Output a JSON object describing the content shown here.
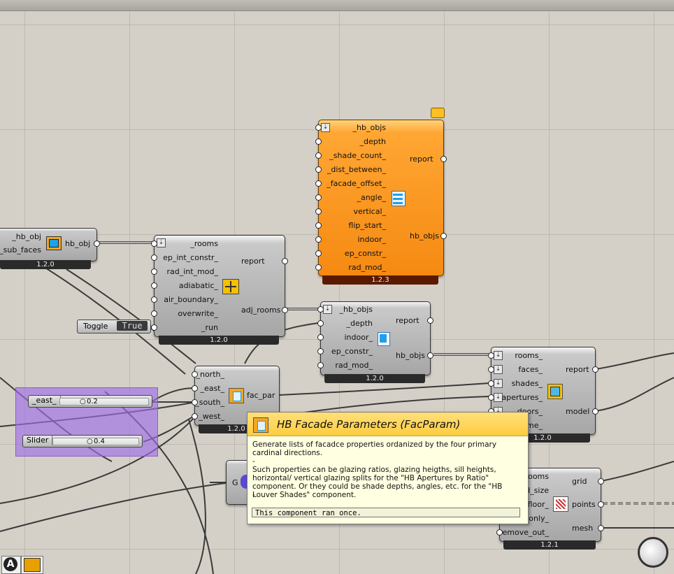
{
  "components": {
    "hb_add_subface": {
      "inputs": [
        "_hb_obj",
        "_sub_faces"
      ],
      "outputs": [
        "hb_obj"
      ],
      "version": "1.2.0"
    },
    "hb_solve_adjacency": {
      "inputs": [
        "_rooms",
        "ep_int_constr_",
        "rad_int_mod_",
        "adiabatic_",
        "air_boundary_",
        "overwrite_",
        "_run"
      ],
      "outputs": [
        "report",
        "adj_rooms"
      ],
      "version": "1.2.0"
    },
    "hb_louver_shades": {
      "inputs": [
        "_hb_objs",
        "_depth",
        "_shade_count_",
        "_dist_between_",
        "_facade_offset_",
        "_angle_",
        "vertical_",
        "flip_start_",
        "indoor_",
        "ep_constr_",
        "rad_mod_"
      ],
      "outputs": [
        "report",
        "hb_objs"
      ],
      "version": "1.2.3"
    },
    "hb_extruded_border": {
      "inputs": [
        "_hb_objs",
        "_depth",
        "indoor_",
        "ep_constr_",
        "rad_mod_"
      ],
      "outputs": [
        "report",
        "hb_objs"
      ],
      "version": "1.2.0"
    },
    "hb_model": {
      "inputs": [
        "rooms_",
        "faces_",
        "shades_",
        "apertures_",
        "doors_",
        "name_"
      ],
      "outputs": [
        "report",
        "model"
      ],
      "version": "1.2.0"
    },
    "hb_facade_parameters": {
      "inputs": [
        "_north_",
        "_east_",
        "_south_",
        "_west_"
      ],
      "outputs": [
        "fac_par"
      ],
      "version": "1.2.0"
    },
    "sensor_grid": {
      "inputs": [
        "rooms",
        "d_size",
        "floor_",
        "_only_",
        "remove_out_"
      ],
      "outputs": [
        "grid",
        "points",
        "mesh"
      ],
      "version": "1.2.1"
    },
    "g_component": {
      "label": "G"
    }
  },
  "toggle": {
    "label": "Toggle",
    "value": "True"
  },
  "sliders": [
    {
      "name": "_east_",
      "value": "0.2"
    },
    {
      "name": "Slider",
      "value": "0.4"
    }
  ],
  "tooltip": {
    "title": "HB Facade Parameters (FacParam)",
    "line1": "Generate lists of facadce properties ordanized by the four primary cardinal directions.",
    "line2": "-",
    "line3": "Such properties can be glazing ratios, glazing heigths, sill heights, horizontal/ vertical glazing splits for the \"HB Apertures by Ratio\" component. Or they could be shade depths, angles, etc. for the \"HB Louver Shades\" component.",
    "line4": "-",
    "status": "This component ran once."
  },
  "colors": {
    "canvas": "#d4d0c8",
    "component": "#a6a6a6",
    "selected_component": "#f58a12",
    "group": "#a06ee6",
    "tooltip_bg": "#ffffe1",
    "tooltip_head": "#ffcc40"
  },
  "icons": {
    "subface": "blue-window-icon",
    "adjacency": "orange-grid-icon",
    "louver": "blue-louver-icon",
    "border": "blue-frame-icon",
    "model": "model-cube-icon",
    "facpar": "facade-params-icon",
    "grid": "sensor-grid-icon",
    "bubble": "speech-bubble-icon",
    "status_a": "letter-a-icon",
    "status_b": "speaker-icon",
    "navigation": "compass-wheel-icon"
  }
}
